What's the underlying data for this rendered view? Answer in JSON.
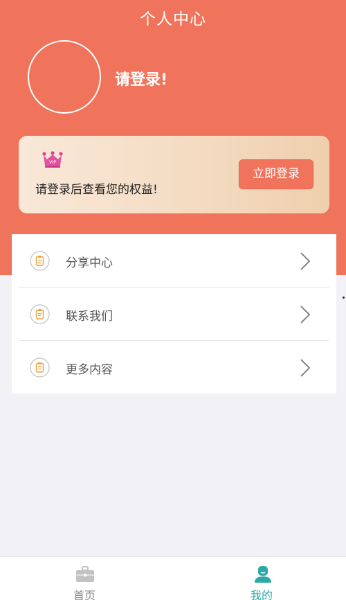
{
  "header": {
    "title": "个人中心"
  },
  "profile": {
    "login_prompt": "请登录!"
  },
  "vip_card": {
    "badge_icon": "crown-vip-icon",
    "badge_text": "VIP",
    "message": "请登录后查看您的权益!",
    "login_button": "立即登录"
  },
  "menu": {
    "items": [
      {
        "icon": "clipboard-icon",
        "label": "分享中心"
      },
      {
        "icon": "clipboard-icon",
        "label": "联系我们"
      },
      {
        "icon": "clipboard-icon",
        "label": "更多内容"
      }
    ]
  },
  "tabbar": {
    "items": [
      {
        "icon": "briefcase-icon",
        "label": "首页",
        "active": false
      },
      {
        "icon": "user-icon",
        "label": "我的",
        "active": true
      }
    ]
  },
  "colors": {
    "primary": "#f0745c",
    "active_tab": "#2aa9a6",
    "inactive_tab": "#8a8a8a",
    "background": "#f2f1f6"
  }
}
